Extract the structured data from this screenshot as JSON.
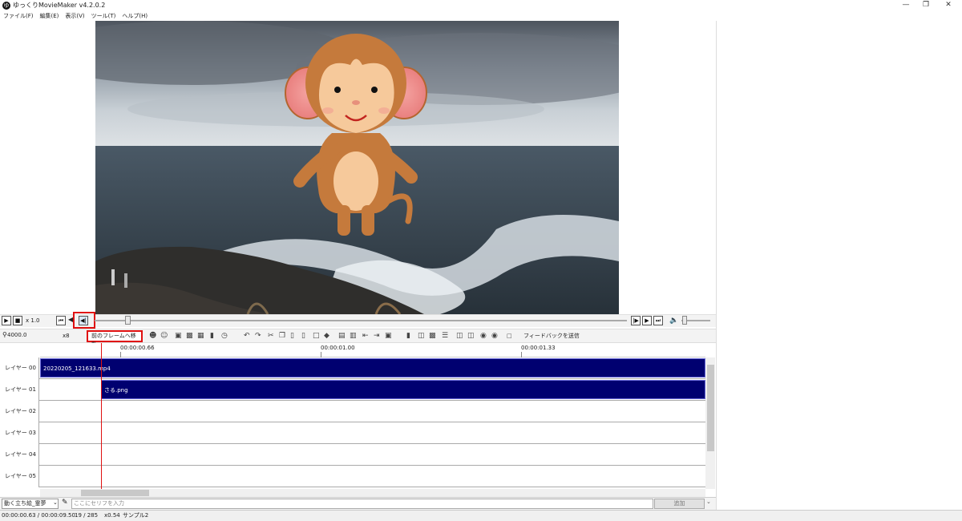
{
  "window": {
    "title": "ゆっくりMovieMaker v4.2.0.2",
    "icon_letter": "ゆ"
  },
  "menu": [
    "ファイル(F)",
    "編集(E)",
    "表示(V)",
    "ツール(T)",
    "ヘルプ(H)"
  ],
  "playback": {
    "speed": "x 1.0",
    "seek_fraction": 0.06
  },
  "toolbar": {
    "zoom": "4000.0",
    "zoom_suffix": "x8",
    "tooltip": "前のフレームへ移動",
    "feedback": "フィードバックを送信"
  },
  "ruler": [
    "00:00:00.66",
    "00:00:01.00",
    "00:00:01.33"
  ],
  "layers": [
    {
      "label": "レイヤー 00",
      "clip": "20220205_121633.mp4"
    },
    {
      "label": "レイヤー 01",
      "clip": "さる.png"
    },
    {
      "label": "レイヤー 02",
      "clip": ""
    },
    {
      "label": "レイヤー 03",
      "clip": ""
    },
    {
      "label": "レイヤー 04",
      "clip": ""
    },
    {
      "label": "レイヤー 05",
      "clip": ""
    }
  ],
  "input": {
    "character": "動く立ち絵_霊夢",
    "placeholder": "ここにセリフを入力",
    "add_label": "追加"
  },
  "status": {
    "time": "00:00:00.63 / 00:00:09.50",
    "frames": "19 / 285",
    "scale": "x0.54",
    "sample": "サンプル2"
  },
  "colors": {
    "clip": "#000070",
    "playhead": "#e01010",
    "highlight": "#e01010"
  }
}
